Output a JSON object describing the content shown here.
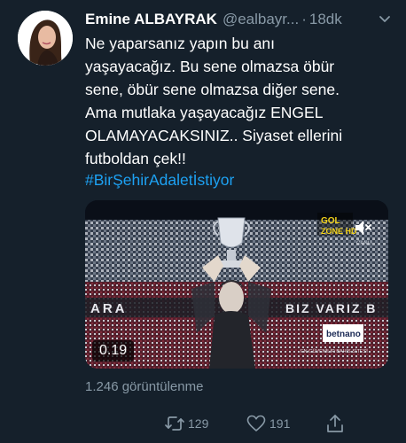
{
  "tweet": {
    "author_name": "Emine ALBAYRAK",
    "handle": "@ealbayr...",
    "separator": "·",
    "time": "18dk",
    "lines": [
      "Ne yaparsanız yapın bu anı",
      "yaşayacağız. Bu sene olmazsa öbür",
      "sene, öbür sene olmazsa diğer sene.",
      "Ama mutlaka yaşayacağız ENGEL",
      "OLAMAYACAKSINIZ.. Siyaset ellerini",
      "futboldan çek!!"
    ],
    "hashtag": "#BirŞehirAdaletİstiyor"
  },
  "media": {
    "timer": "0.19",
    "banner_left": "ARA",
    "banner_right": "BIZ VARIZ B",
    "sponsor": "betnano",
    "channel_top": "GOL",
    "channel_bottom": "ZONE HD",
    "channel_sub": "CANLI",
    "footer_text": "EN GÜVENİLİR BAHİS SİTESİ"
  },
  "stats": {
    "views": "1.246 görüntülenme",
    "retweets": "129",
    "likes": "191"
  },
  "colors": {
    "background": "#15202b",
    "accent": "#1da1f2",
    "muted": "#8899a6"
  },
  "icons": [
    "chevron-down-icon",
    "mute-icon",
    "retweet-icon",
    "like-icon",
    "share-icon"
  ]
}
